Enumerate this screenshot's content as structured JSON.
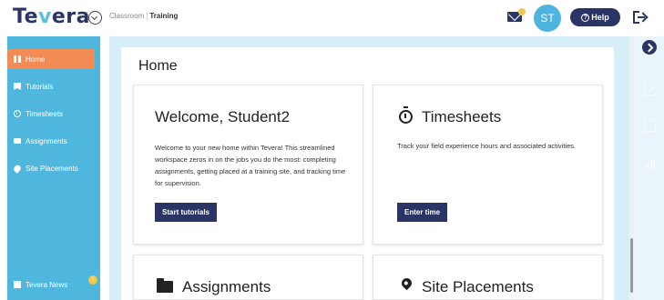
{
  "header": {
    "logo_text_prefix": "Te",
    "logo_text_accent": "v",
    "logo_text_suffix": "era",
    "breadcrumb": {
      "parent": "Classroom",
      "current": "Training"
    },
    "avatar_initials": "ST",
    "help_label": "Help",
    "icons": [
      "chevron-circle-icon",
      "mail-icon",
      "logout-icon"
    ]
  },
  "sidebar": {
    "items": [
      {
        "label": "Home",
        "icon": "home-icon",
        "active": true
      },
      {
        "label": "Tutorials",
        "icon": "tutorials-icon",
        "active": false
      },
      {
        "label": "Timesheets",
        "icon": "stopwatch-icon",
        "active": false
      },
      {
        "label": "Assignments",
        "icon": "folder-icon",
        "active": false
      },
      {
        "label": "Site Placements",
        "icon": "pin-icon",
        "active": false
      }
    ],
    "news": {
      "label": "Tevera News",
      "icon": "news-icon"
    }
  },
  "main": {
    "title": "Home",
    "cards": {
      "welcome": {
        "title": "Welcome, Student2",
        "description": "Welcome to your new home within Tevera! This streamlined workspace zeros in on the jobs you do the most: completing assignments, getting placed at a training site, and tracking time for supervision.",
        "button": "Start tutorials"
      },
      "timesheets": {
        "title": "Timesheets",
        "description": "Track your field experience hours and associated activities.",
        "button": "Enter time"
      },
      "assignments": {
        "title": "Assignments"
      },
      "site_placements": {
        "title": "Site Placements"
      }
    }
  },
  "right_rail": {
    "icons": [
      "expand-icon",
      "chart-icon",
      "document-icon",
      "bar-chart-icon"
    ]
  },
  "colors": {
    "brand_navy": "#2a3566",
    "sidebar_blue": "#4fb7de",
    "active_orange": "#f28b55",
    "content_bg": "#d6eef7",
    "badge_yellow": "#f2c94c"
  }
}
